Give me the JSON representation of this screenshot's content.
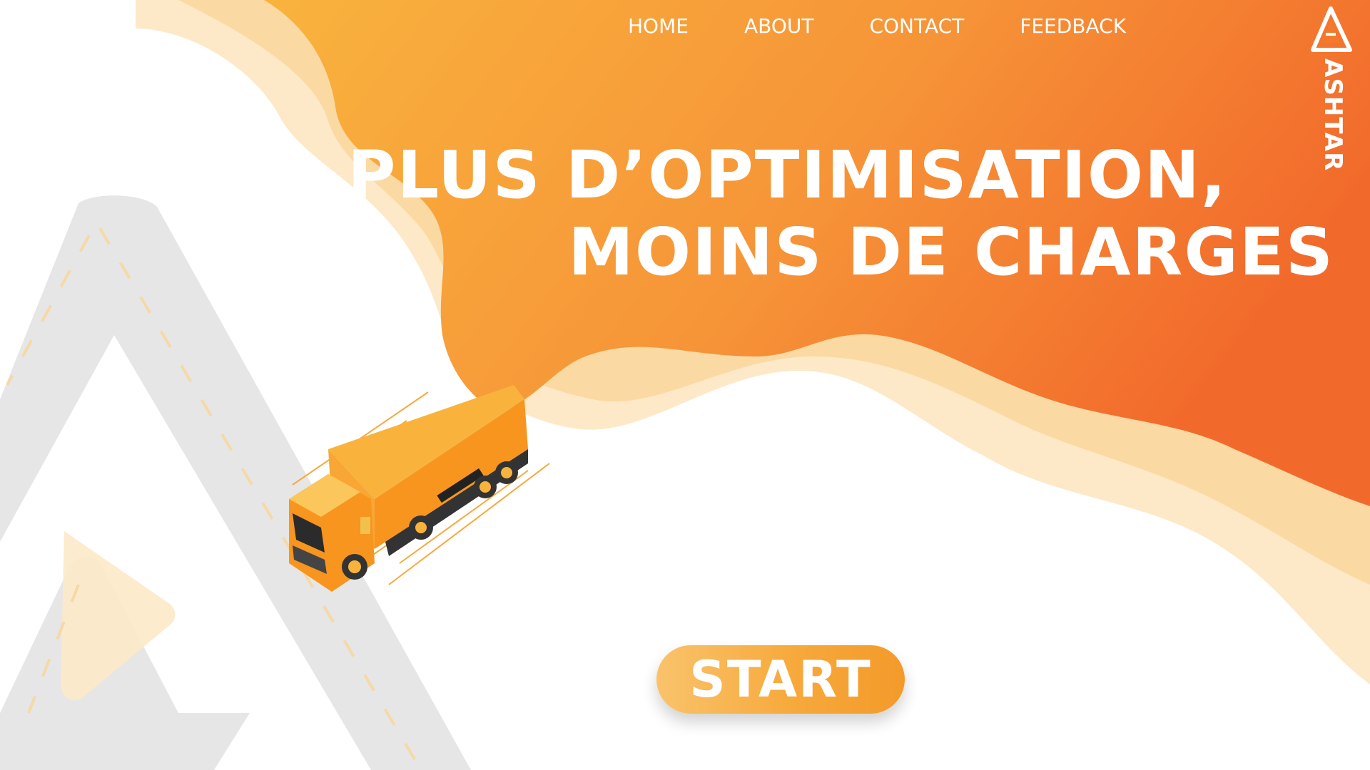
{
  "nav": {
    "items": [
      {
        "label": "HOME"
      },
      {
        "label": "ABOUT"
      },
      {
        "label": "CONTACT"
      },
      {
        "label": "FEEDBACK"
      }
    ]
  },
  "brand": {
    "name": "ASHTAR",
    "logo_icon": "triangle-road-logo-icon"
  },
  "hero": {
    "headline_line1": "PLUS D’OPTIMISATION,",
    "headline_line2": "MOINS DE CHARGES",
    "illustration_icon": "orange-truck-icon"
  },
  "cta": {
    "start_label": "START"
  },
  "colors": {
    "orange_light": "#f9b33d",
    "orange_dark": "#f26a2b",
    "peach": "#fbd9a3",
    "cream": "#fde9c8",
    "road_gray": "#e6e6e6",
    "white": "#ffffff"
  }
}
